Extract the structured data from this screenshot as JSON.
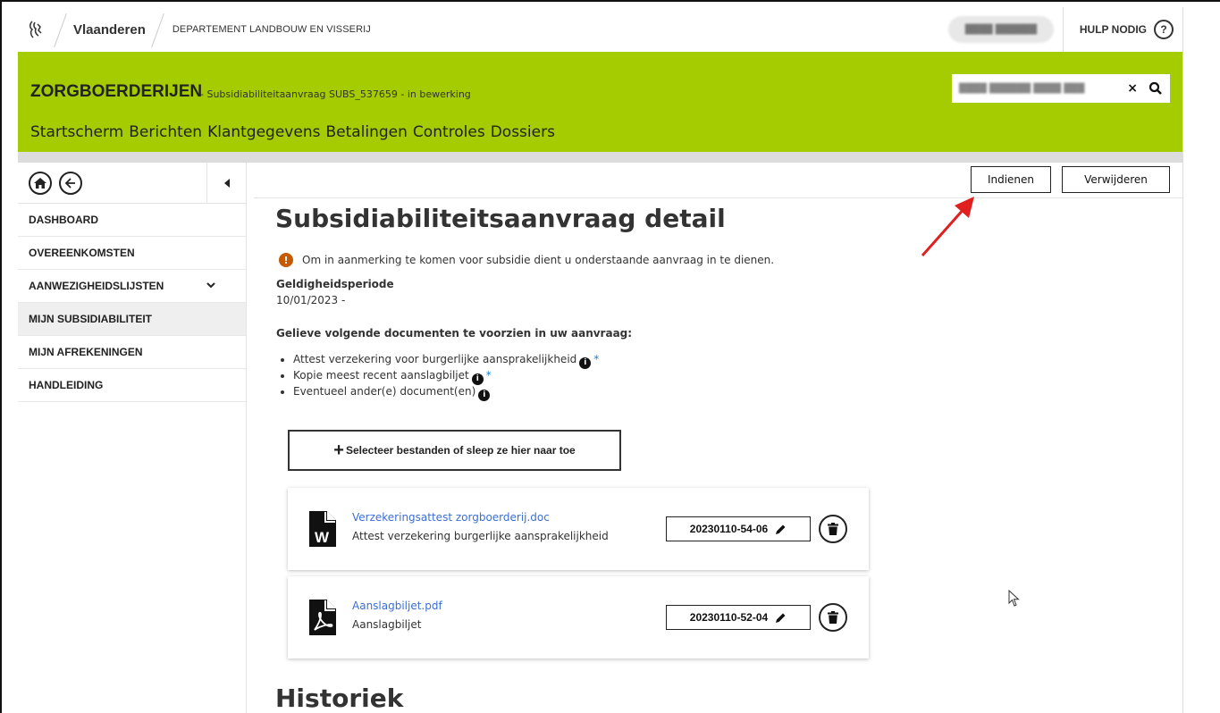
{
  "topbar": {
    "brand": "Vlaanderen",
    "department": "DEPARTEMENT LANDBOUW EN VISSERIJ",
    "user_name": "████ ██████",
    "help_label": "HULP NODIG",
    "help_icon_text": "?"
  },
  "header": {
    "app_title": "ZORGBOERDERIJEN",
    "subtitle": "- Subsidiabiliteitaanvraag SUBS_537659 - in bewerking",
    "search_value": "████ ██████ ████ ███",
    "search_clear": "×",
    "nav": [
      "Startscherm",
      "Berichten",
      "Klantgegevens",
      "Betalingen",
      "Controles",
      "Dossiers"
    ]
  },
  "sidebar": {
    "items": [
      {
        "label": "DASHBOARD",
        "active": false
      },
      {
        "label": "OVEREENKOMSTEN",
        "active": false
      },
      {
        "label": "AANWEZIGHEIDSLIJSTEN",
        "active": false
      },
      {
        "label": "MIJN SUBSIDIABILITEIT",
        "active": true
      },
      {
        "label": "MIJN AFREKENINGEN",
        "active": false
      },
      {
        "label": "HANDLEIDING",
        "active": false
      }
    ]
  },
  "toolbar": {
    "submit_label": "Indienen",
    "delete_label": "Verwijderen"
  },
  "main": {
    "title": "Subsidiabiliteitsaanvraag detail",
    "notice": "Om in aanmerking te komen voor subsidie dient u onderstaande aanvraag in te dienen.",
    "validity_label": "Geldigheidsperiode",
    "validity_value": "10/01/2023 -",
    "docs_heading": "Gelieve volgende documenten te voorzien in uw aanvraag:",
    "docs": [
      {
        "label": "Attest verzekering voor burgerlijke aansprakelijkheid",
        "required": "*"
      },
      {
        "label": "Kopie meest recent aanslagbiljet",
        "required": "*"
      },
      {
        "label": "Eventueel ander(e) document(en)",
        "required": ""
      }
    ],
    "upload_label": "Selecteer bestanden of sleep ze hier naar toe",
    "files": [
      {
        "name": "Verzekeringsattest zorgboerderij.doc",
        "type": "Attest verzekering burgerlijke aansprakelijkheid",
        "date": "20230110-54-06",
        "icon": "word-file-icon"
      },
      {
        "name": "Aanslagbiljet.pdf",
        "type": "Aanslagbiljet",
        "date": "20230110-52-04",
        "icon": "pdf-file-icon"
      }
    ],
    "history_title": "Historiek"
  },
  "colors": {
    "brand_green": "#a4cc00",
    "warning": "#c55a00",
    "link": "#3a6fd8",
    "annotation_arrow": "#e02020"
  }
}
